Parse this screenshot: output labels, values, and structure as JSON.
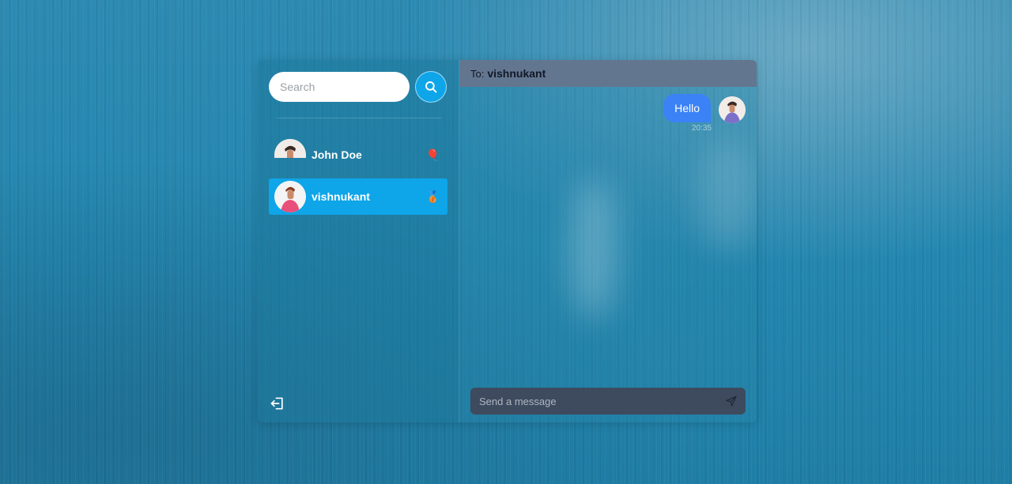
{
  "sidebar": {
    "search": {
      "placeholder": "Search"
    },
    "conversations": [
      {
        "name": "John Doe",
        "emoji": "🎈",
        "active": false
      },
      {
        "name": "vishnukant",
        "emoji": "🥉",
        "active": true
      }
    ]
  },
  "chat": {
    "header": {
      "to_label": "To:",
      "recipient": "vishnukant"
    },
    "messages": [
      {
        "text": "Hello",
        "time": "20:35",
        "from_me": true
      }
    ],
    "composer": {
      "placeholder": "Send a message"
    }
  },
  "icons": {
    "search": "search-icon",
    "logout": "logout-icon",
    "send": "send-icon"
  },
  "colors": {
    "accent": "#0ea5e9",
    "bubble": "#3b82f6",
    "header": "#63768f",
    "composer": "#3e4a5e"
  }
}
